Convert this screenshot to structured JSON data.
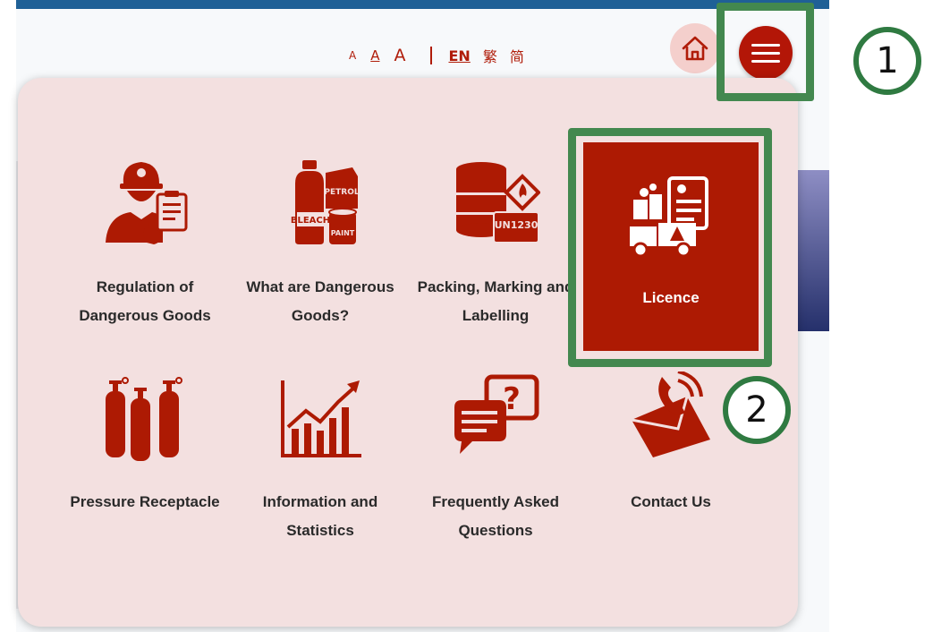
{
  "header": {
    "font_sizes": [
      "A",
      "A",
      "A"
    ],
    "languages": {
      "en": "EN",
      "tc": "繁",
      "sc": "简"
    }
  },
  "menu": {
    "items": [
      {
        "label": "Regulation of Dangerous Goods",
        "icon": "firefighter-icon"
      },
      {
        "label": "What are Dangerous Goods?",
        "icon": "chemical-bottles-icon"
      },
      {
        "label": "Packing, Marking and Labelling",
        "icon": "barrel-label-icon"
      },
      {
        "label": "Licence",
        "icon": "licence-icon",
        "active": true
      },
      {
        "label": "Pressure Receptacle",
        "icon": "gas-cylinders-icon"
      },
      {
        "label": "Information and Statistics",
        "icon": "bar-chart-icon"
      },
      {
        "label": "Frequently Asked Questions",
        "icon": "faq-chat-icon"
      },
      {
        "label": "Contact Us",
        "icon": "phone-envelope-icon"
      }
    ]
  },
  "annotations": {
    "step1": "1",
    "step2": "2"
  },
  "colors": {
    "accent": "#b31607",
    "panel": "#f3e0e0",
    "highlight": "#43884f",
    "topbar": "#1f6096"
  }
}
